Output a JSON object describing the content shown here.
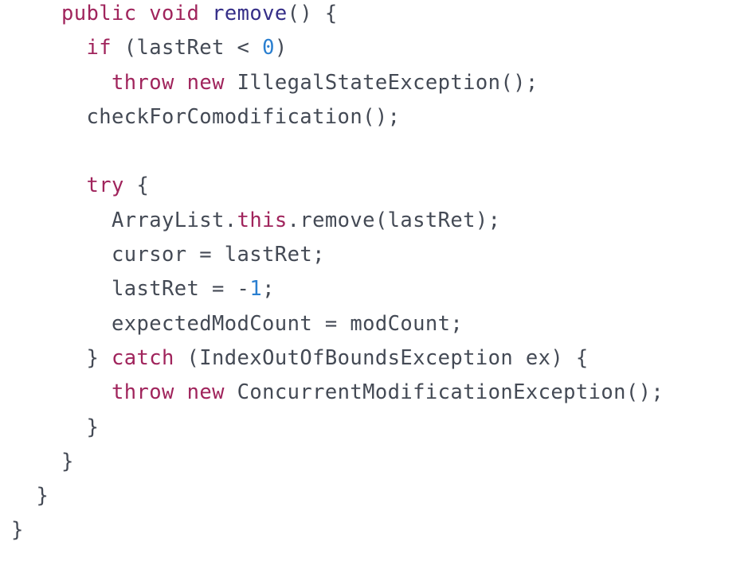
{
  "colors": {
    "keyword": "#a0245c",
    "function_name": "#352e88",
    "number": "#2a7fd0",
    "plain": "#444a55",
    "background": "#ffffff"
  },
  "code": {
    "lines": [
      {
        "indent": 2,
        "tokens": [
          {
            "t": "public",
            "c": "kw"
          },
          {
            "t": " ",
            "c": "plain"
          },
          {
            "t": "void",
            "c": "kw"
          },
          {
            "t": " ",
            "c": "plain"
          },
          {
            "t": "remove",
            "c": "fn"
          },
          {
            "t": "() {",
            "c": "plain"
          }
        ]
      },
      {
        "indent": 3,
        "tokens": [
          {
            "t": "if",
            "c": "kw"
          },
          {
            "t": " (lastRet < ",
            "c": "plain"
          },
          {
            "t": "0",
            "c": "num"
          },
          {
            "t": ")",
            "c": "plain"
          }
        ]
      },
      {
        "indent": 4,
        "tokens": [
          {
            "t": "throw",
            "c": "kw"
          },
          {
            "t": " ",
            "c": "plain"
          },
          {
            "t": "new",
            "c": "kw"
          },
          {
            "t": " IllegalStateException();",
            "c": "plain"
          }
        ]
      },
      {
        "indent": 3,
        "tokens": [
          {
            "t": "checkForComodification();",
            "c": "plain"
          }
        ]
      },
      {
        "indent": 0,
        "tokens": []
      },
      {
        "indent": 3,
        "tokens": [
          {
            "t": "try",
            "c": "kw"
          },
          {
            "t": " {",
            "c": "plain"
          }
        ]
      },
      {
        "indent": 4,
        "tokens": [
          {
            "t": "ArrayList.",
            "c": "plain"
          },
          {
            "t": "this",
            "c": "kw"
          },
          {
            "t": ".remove(lastRet);",
            "c": "plain"
          }
        ]
      },
      {
        "indent": 4,
        "tokens": [
          {
            "t": "cursor = lastRet;",
            "c": "plain"
          }
        ]
      },
      {
        "indent": 4,
        "tokens": [
          {
            "t": "lastRet = -",
            "c": "plain"
          },
          {
            "t": "1",
            "c": "num"
          },
          {
            "t": ";",
            "c": "plain"
          }
        ]
      },
      {
        "indent": 4,
        "tokens": [
          {
            "t": "expectedModCount = modCount;",
            "c": "plain"
          }
        ]
      },
      {
        "indent": 3,
        "tokens": [
          {
            "t": "} ",
            "c": "plain"
          },
          {
            "t": "catch",
            "c": "kw"
          },
          {
            "t": " (IndexOutOfBoundsException ex) {",
            "c": "plain"
          }
        ]
      },
      {
        "indent": 4,
        "tokens": [
          {
            "t": "throw",
            "c": "kw"
          },
          {
            "t": " ",
            "c": "plain"
          },
          {
            "t": "new",
            "c": "kw"
          },
          {
            "t": " ConcurrentModificationException();",
            "c": "plain"
          }
        ]
      },
      {
        "indent": 3,
        "tokens": [
          {
            "t": "}",
            "c": "plain"
          }
        ]
      },
      {
        "indent": 2,
        "tokens": [
          {
            "t": "}",
            "c": "plain"
          }
        ]
      },
      {
        "indent": 1,
        "tokens": [
          {
            "t": "}",
            "c": "plain"
          }
        ]
      },
      {
        "indent": 0,
        "tokens": [
          {
            "t": "}",
            "c": "plain"
          }
        ]
      }
    ]
  }
}
